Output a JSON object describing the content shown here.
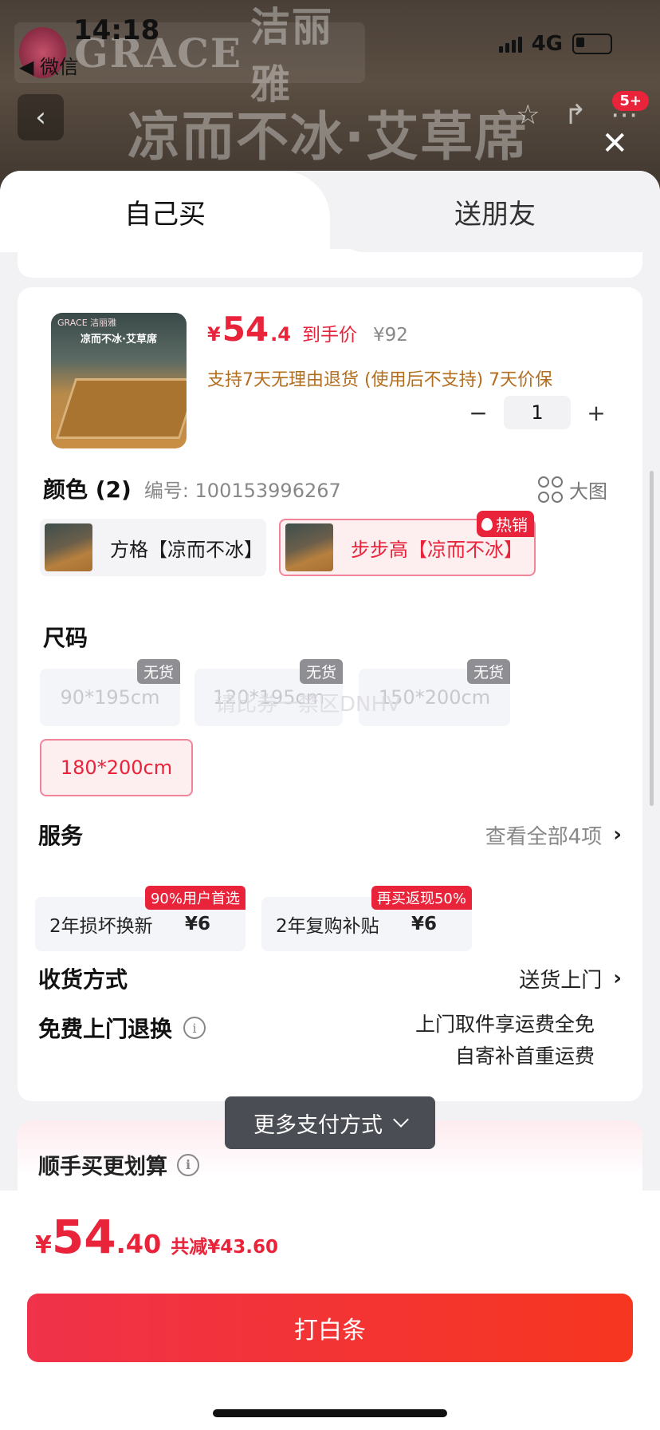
{
  "status_bar": {
    "time": "14:18",
    "back_app": "◀ 微信",
    "network": "4G"
  },
  "background": {
    "brand_en": "GRACE",
    "brand_cn": "洁丽雅",
    "headline": "凉而不冰·艾草席",
    "cart_badge": "5+"
  },
  "tabs": {
    "self_buy": "自己买",
    "gift": "送朋友"
  },
  "product": {
    "thumb_logo": "GRACE 洁丽雅",
    "thumb_title": "凉而不冰·艾草席",
    "price_symbol": "¥",
    "price_int": "54",
    "price_dec": ".4",
    "price_label": "到手价",
    "price_original": "¥92",
    "policy": "支持7天无理由退货 (使用后不支持)  7天价保",
    "quantity": "1",
    "minus": "−",
    "plus": "+"
  },
  "color_section": {
    "title": "颜色 (2)",
    "sku": "编号: 100153996267",
    "big_image": "大图",
    "options": [
      {
        "label": "方格【凉而不冰】",
        "selected": false
      },
      {
        "label": "步步高【凉而不冰】",
        "selected": true,
        "tag": "热销"
      }
    ]
  },
  "size_section": {
    "title": "尺码",
    "options": [
      {
        "label": "90*195cm",
        "tag": "无货"
      },
      {
        "label": "120*195cm",
        "tag": "无货"
      },
      {
        "label": "150*200cm",
        "tag": "无货"
      },
      {
        "label": "180*200cm",
        "selected": true
      }
    ],
    "watermark": "请比券一禁区DNHV"
  },
  "services": {
    "title": "服务",
    "view_all": "查看全部4项",
    "items": [
      {
        "name": "2年损坏换新",
        "price": "¥6",
        "tag": "90%用户首选"
      },
      {
        "name": "2年复购补贴",
        "price": "¥6",
        "tag": "再买返现50%"
      }
    ]
  },
  "shipping": {
    "title": "收货方式",
    "value": "送货上门",
    "return_title": "免费上门退换",
    "return_line1": "上门取件享运费全免",
    "return_line2": "自寄补首重运费"
  },
  "addon": {
    "title": "顺手买更划算",
    "more_pay": "更多支付方式"
  },
  "footer": {
    "symbol": "¥",
    "total_int": "54",
    "total_dec": ".40",
    "saving": "共减¥43.60",
    "cta": "打白条"
  },
  "colors": {
    "accent": "#e8233a",
    "policy": "#b26d1e",
    "toast": "#4b4d55"
  }
}
